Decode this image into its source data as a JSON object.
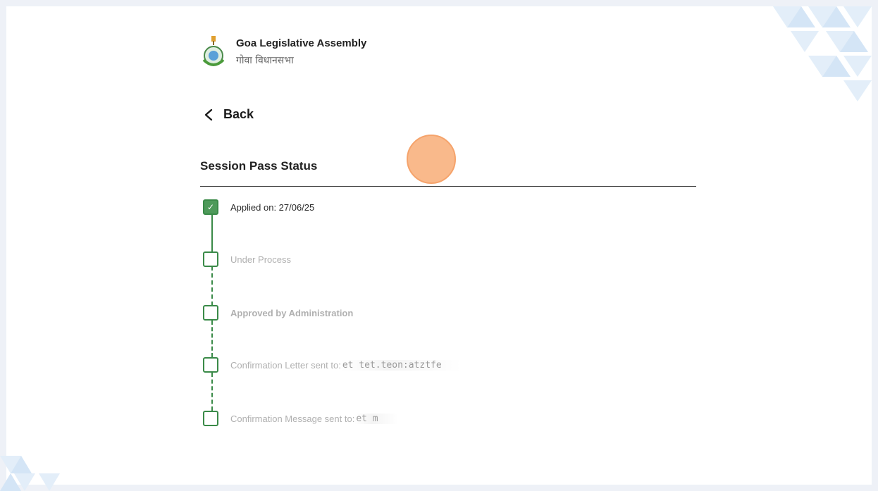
{
  "header": {
    "title": "Goa Legislative Assembly",
    "subtitle": "गोवा विधानसभा"
  },
  "nav": {
    "back_label": "Back"
  },
  "section": {
    "title": "Session Pass Status"
  },
  "steps": [
    {
      "label": "Applied on: 27/06/25",
      "status": "done",
      "check": "✓"
    },
    {
      "label": "Under Process",
      "status": "pending"
    },
    {
      "label": "Approved by Administration",
      "status": "pending"
    },
    {
      "label": "Confirmation Letter sent to:",
      "masked_value": "et tet.teon:atztfe",
      "status": "pending"
    },
    {
      "label": "Confirmation Message sent to:",
      "masked_value": "et m",
      "status": "pending"
    }
  ],
  "colors": {
    "accent_green": "#3a8a48",
    "cursor_orange": "#f9b27f"
  },
  "icons": {
    "back": "chevron-left-icon",
    "emblem": "goa-emblem-icon",
    "check": "check-icon"
  }
}
